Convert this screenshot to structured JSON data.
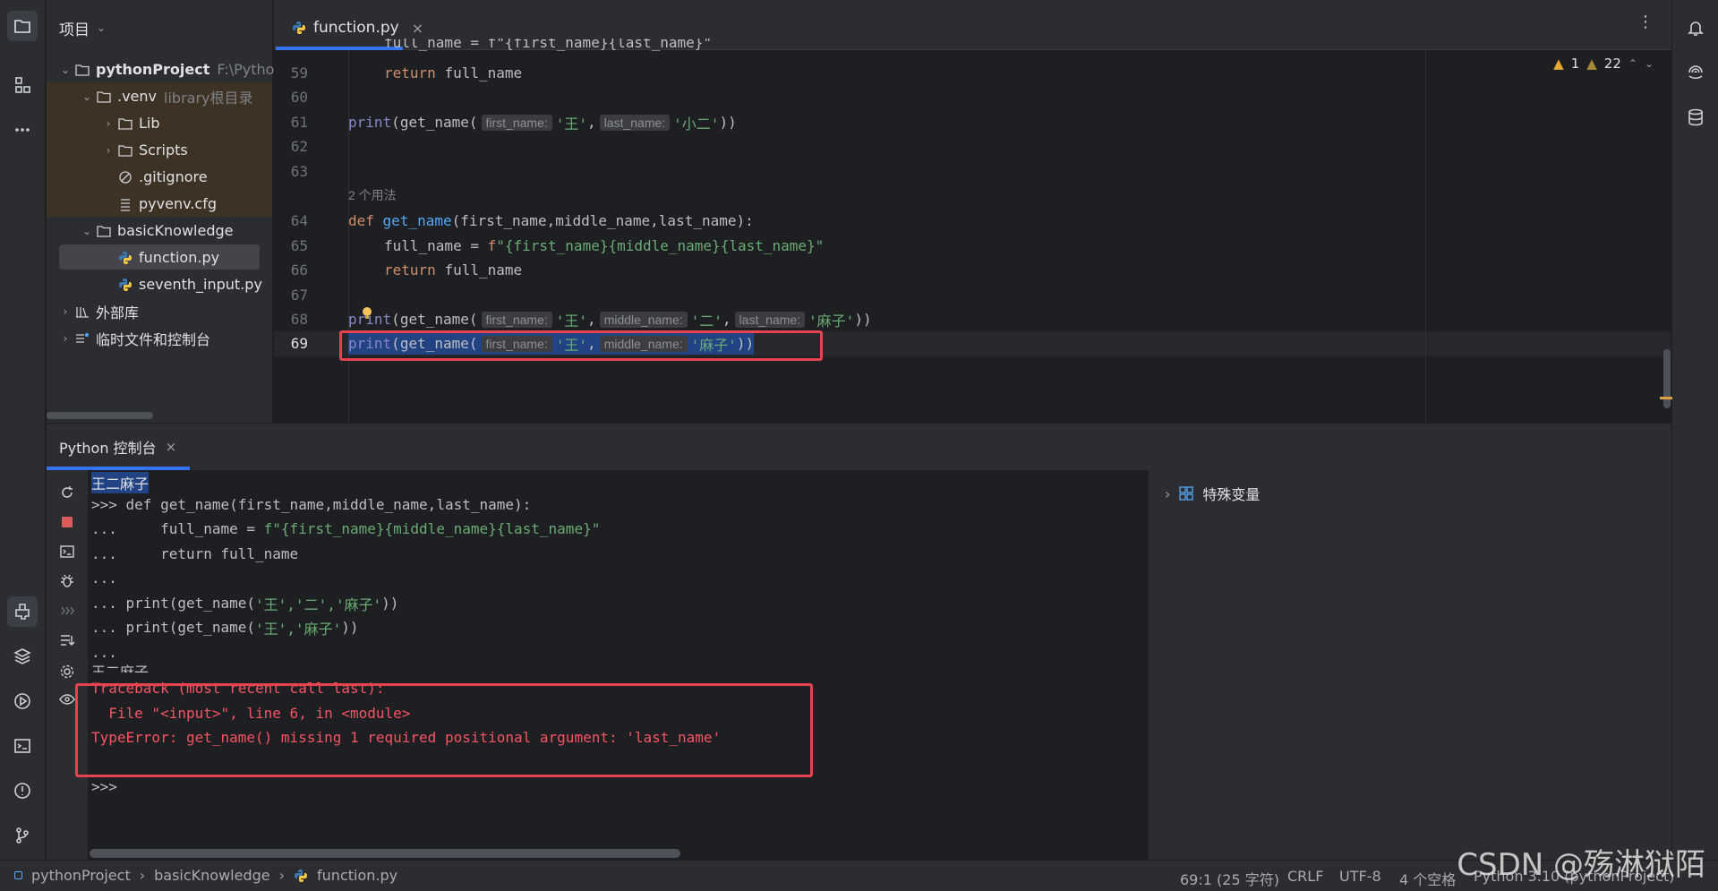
{
  "project_panel": {
    "title": "项目",
    "root": {
      "name": "pythonProject",
      "path": "F:\\Pytho"
    },
    "venv": {
      "name": ".venv",
      "note": "library根目录"
    },
    "items": {
      "lib": "Lib",
      "scripts": "Scripts",
      "gitignore": ".gitignore",
      "pyvenv": "pyvenv.cfg",
      "basic": "basicKnowledge",
      "function": "function.py",
      "seventh": "seventh_input.py",
      "external": "外部库",
      "scratch": "临时文件和控制台"
    }
  },
  "editor": {
    "tab_label": "function.py",
    "warnings": {
      "warn1": "1",
      "warn22": "22"
    },
    "usage_hint": "2 个用法",
    "lines": {
      "n59": "59",
      "n60": "60",
      "n61": "61",
      "n62": "62",
      "n63": "63",
      "n64": "64",
      "n65": "65",
      "n66": "66",
      "n67": "67",
      "n68": "68",
      "n69": "69"
    },
    "hints": {
      "first_name": "first_name:",
      "middle_name": "middle_name:",
      "last_name": "last_name:"
    },
    "code": {
      "top_partial": "full_name = f\"{first_name}{last_name}\"",
      "return_kw": "return",
      "full_name": "full_name",
      "print": "print",
      "get_name": "get_name",
      "open": "(",
      "close": "))",
      "comma": ",",
      "wang": "'王'",
      "xiaoer": "'小二'",
      "er": "'二'",
      "mazi": "'麻子'",
      "def_kw": "def",
      "params": "(first_name,middle_name,last_name):",
      "assign": "full_name = ",
      "fprefix": "f",
      "fbody": "\"{first_name}{middle_name}{last_name}\""
    }
  },
  "console": {
    "tab_label": "Python 控制台",
    "lines": {
      "out1": "王二麻子",
      "l2": ">>> def get_name(first_name,middle_name,last_name):",
      "l3a": "...     full_name = ",
      "l3b": "f\"{first_name}{middle_name}{last_name}\"",
      "l4": "...     return full_name",
      "l5": "...",
      "l6a": "... print(get_name(",
      "l6b": "'王','二','麻子'",
      "l6c": "))",
      "l7a": "... print(get_name(",
      "l7b": "'王','麻子'",
      "l7c": "))",
      "l8": "...",
      "out2": "王二麻子",
      "err1": "Traceback (most recent call last):",
      "err2": "  File \"<input>\", line 6, in <module>",
      "err3": "TypeError: get_name() missing 1 required positional argument: 'last_name'",
      "prompt": ">>>"
    },
    "vars_label": "特殊变量"
  },
  "status_bar": {
    "crumb_project": "pythonProject",
    "crumb_folder": "basicKnowledge",
    "crumb_file": "function.py",
    "position": "69:1 (25 字符)",
    "line_sep": "CRLF",
    "encoding": "UTF-8",
    "indent": "4 个空格",
    "interpreter": "Python 3.10 (pythonProject)"
  },
  "watermark": "CSDN @殇淋狱陌",
  "colors": {
    "accent": "#3574f0",
    "error": "#f75464",
    "highlight_box": "#e5434f",
    "string": "#6aab73",
    "keyword": "#cf8e6d",
    "function": "#56a8f5"
  }
}
